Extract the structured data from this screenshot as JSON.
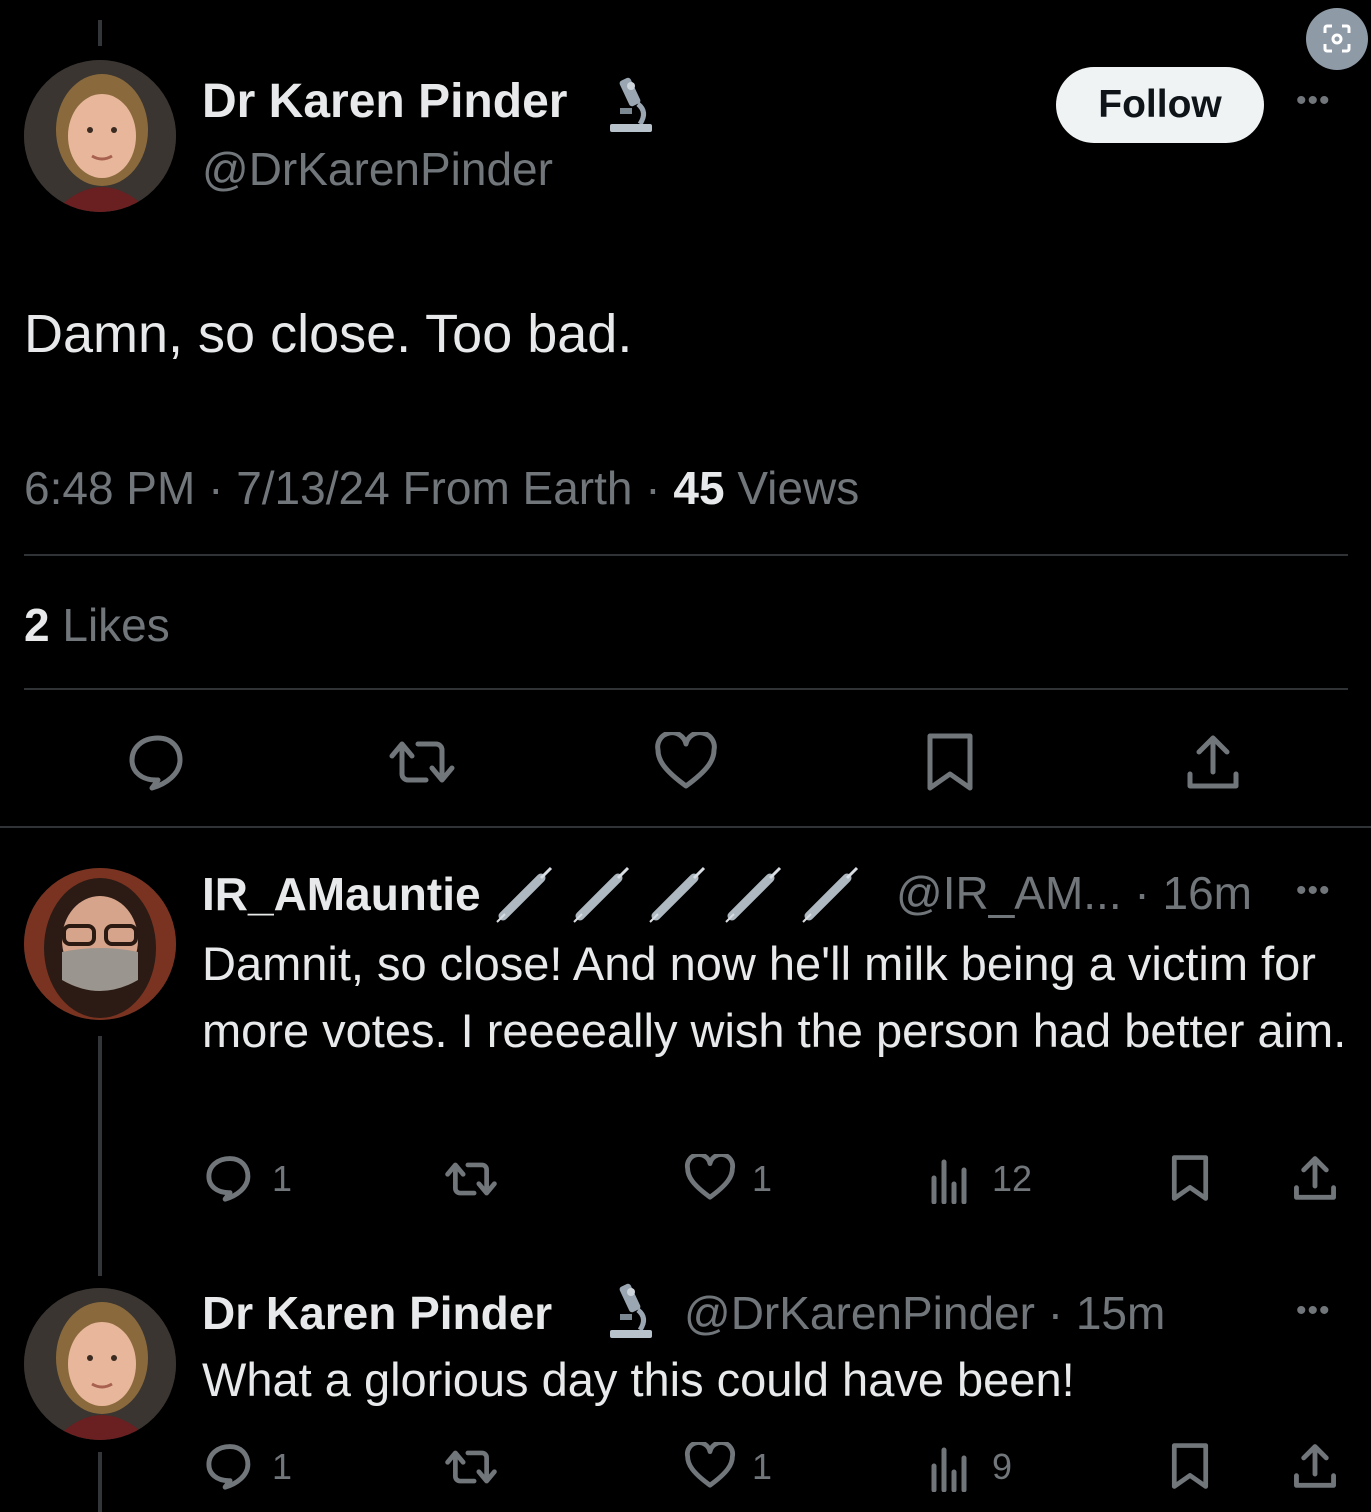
{
  "tweet": {
    "author_name": "Dr Karen Pinder",
    "author_handle": "@DrKarenPinder",
    "follow_label": "Follow",
    "text": "Damn, so close. Too bad.",
    "meta_time": "6:48 PM · 7/13/24 From Earth · ",
    "meta_views_count": "45",
    "meta_views_label": " Views",
    "likes_count": "2",
    "likes_label": " Likes"
  },
  "reply1": {
    "author_name": "IR_AMauntie",
    "meta": "@IR_AM... · 16m",
    "text": "Damnit, so close! And now he'll milk being a victim for more votes. I reeeeally wish the person had better aim.",
    "replies": "1",
    "likes": "1",
    "views": "12"
  },
  "reply2": {
    "author_name": "Dr Karen Pinder",
    "meta": "@DrKarenPinder · 15m",
    "text": "What a glorious day this could have been!",
    "replies": "1",
    "likes": "1",
    "views": "9"
  },
  "icons": {
    "badge": "microscope-icon",
    "reply1_badges": "syringe-icon",
    "actions": [
      "reply-icon",
      "retweet-icon",
      "like-icon",
      "views-icon",
      "bookmark-icon",
      "share-icon"
    ]
  },
  "colors": {
    "background": "#000000",
    "text": "#e7e9ea",
    "muted": "#71767b",
    "follow_button": "#eff3f4"
  }
}
